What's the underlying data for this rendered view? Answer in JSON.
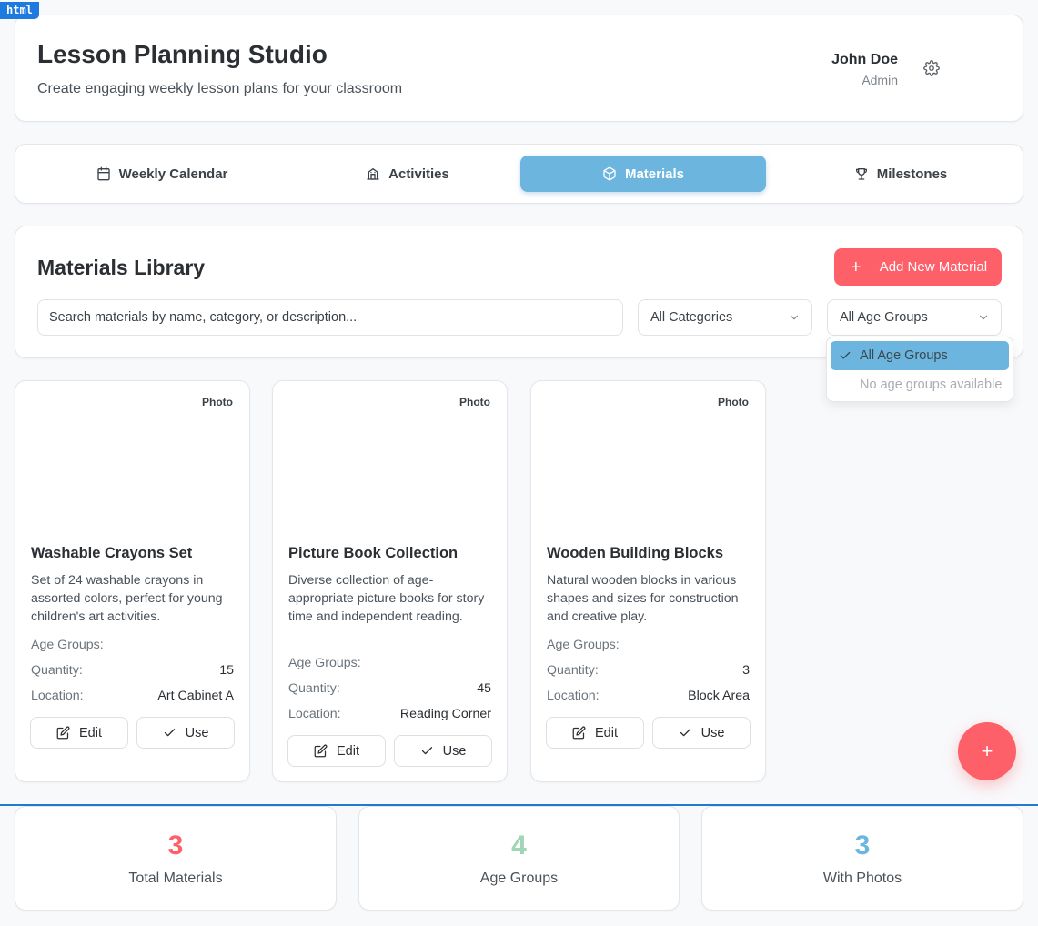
{
  "header": {
    "title": "Lesson Planning Studio",
    "subtitle": "Create engaging weekly lesson plans for your classroom",
    "user_name": "John Doe",
    "user_role": "Admin",
    "settings_icon": "gear-icon"
  },
  "tabs": [
    {
      "label": "Weekly Calendar",
      "icon": "calendar-icon",
      "active": false
    },
    {
      "label": "Activities",
      "icon": "building-icon",
      "active": false
    },
    {
      "label": "Materials",
      "icon": "box-icon",
      "active": true
    },
    {
      "label": "Milestones",
      "icon": "trophy-icon",
      "active": false
    }
  ],
  "library": {
    "title": "Materials Library",
    "add_button": "Add New Material",
    "search_placeholder": "Search materials by name, category, or description...",
    "category_select": "All Categories",
    "age_select": "All Age Groups"
  },
  "age_dropdown": {
    "options": [
      "All Age Groups",
      "No age groups available"
    ],
    "selected": "All Age Groups"
  },
  "materials": [
    {
      "photo_label": "Photo",
      "name": "Washable Crayons Set",
      "description": "Set of 24 washable crayons in assorted colors, perfect for young children's art activities.",
      "age_groups_label": "Age Groups:",
      "quantity_label": "Quantity:",
      "quantity": "15",
      "location_label": "Location:",
      "location": "Art Cabinet A",
      "edit_label": "Edit",
      "use_label": "Use"
    },
    {
      "photo_label": "Photo",
      "name": "Picture Book Collection",
      "description": "Diverse collection of age-appropriate picture books for story time and independent reading.",
      "age_groups_label": "Age Groups:",
      "quantity_label": "Quantity:",
      "quantity": "45",
      "location_label": "Location:",
      "location": "Reading Corner",
      "edit_label": "Edit",
      "use_label": "Use"
    },
    {
      "photo_label": "Photo",
      "name": "Wooden Building Blocks",
      "description": "Natural wooden blocks in various shapes and sizes for construction and creative play.",
      "age_groups_label": "Age Groups:",
      "quantity_label": "Quantity:",
      "quantity": "3",
      "location_label": "Location:",
      "location": "Block Area",
      "edit_label": "Edit",
      "use_label": "Use"
    }
  ],
  "fab_label": "+",
  "stats": [
    {
      "value": "3",
      "label": "Total Materials",
      "color": "#fd6068"
    },
    {
      "value": "4",
      "label": "Age Groups",
      "color": "#9fd6b4"
    },
    {
      "value": "3",
      "label": "With Photos",
      "color": "#6bb5de"
    }
  ],
  "colors": {
    "accent": "#fd6068",
    "tab_active": "#6bb5de",
    "divider": "#1f7ad0"
  }
}
